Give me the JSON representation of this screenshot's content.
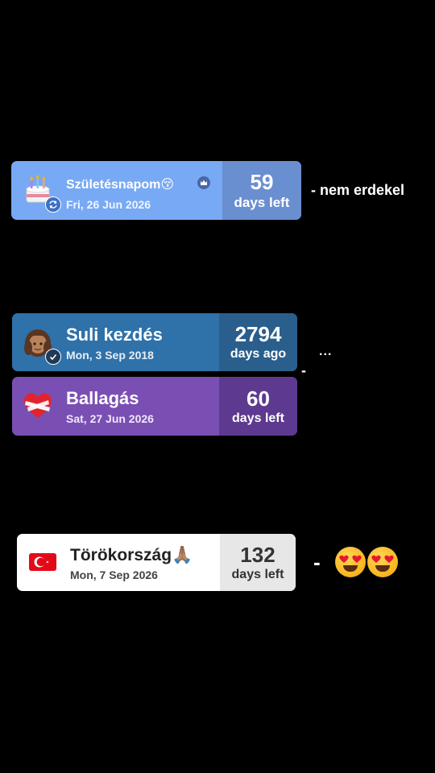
{
  "cards": [
    {
      "emoji": "🎂",
      "title": "Születésnapom😚",
      "date": "Fri, 26 Jun 2026",
      "count": "59",
      "unit": "days left",
      "badge_icon": "repeat-icon",
      "extra_icon": "crown-icon",
      "accent": "#78a9f4"
    },
    {
      "emoji": "👧🏽",
      "title": "Suli kezdés",
      "date": "Mon, 3 Sep 2018",
      "count": "2794",
      "unit": "days ago",
      "badge_icon": "checkmark-icon",
      "accent": "#2f71a9"
    },
    {
      "emoji": "❤️‍🩹",
      "title": "Ballagás",
      "date": "Sat, 27 Jun 2026",
      "count": "60",
      "unit": "days left",
      "accent": "#7a4fb4"
    },
    {
      "emoji": "🇹🇷",
      "title": "Törökország🙏🏽",
      "date": "Mon, 7 Sep 2026",
      "count": "132",
      "unit": "days left",
      "accent": "#ffffff"
    }
  ],
  "notes": {
    "first": "- nem erdekel",
    "second": "...",
    "second_dash": "-",
    "third": "-",
    "third_emojis": [
      "heart-eyes-face-icon",
      "heart-eyes-face-icon"
    ]
  }
}
